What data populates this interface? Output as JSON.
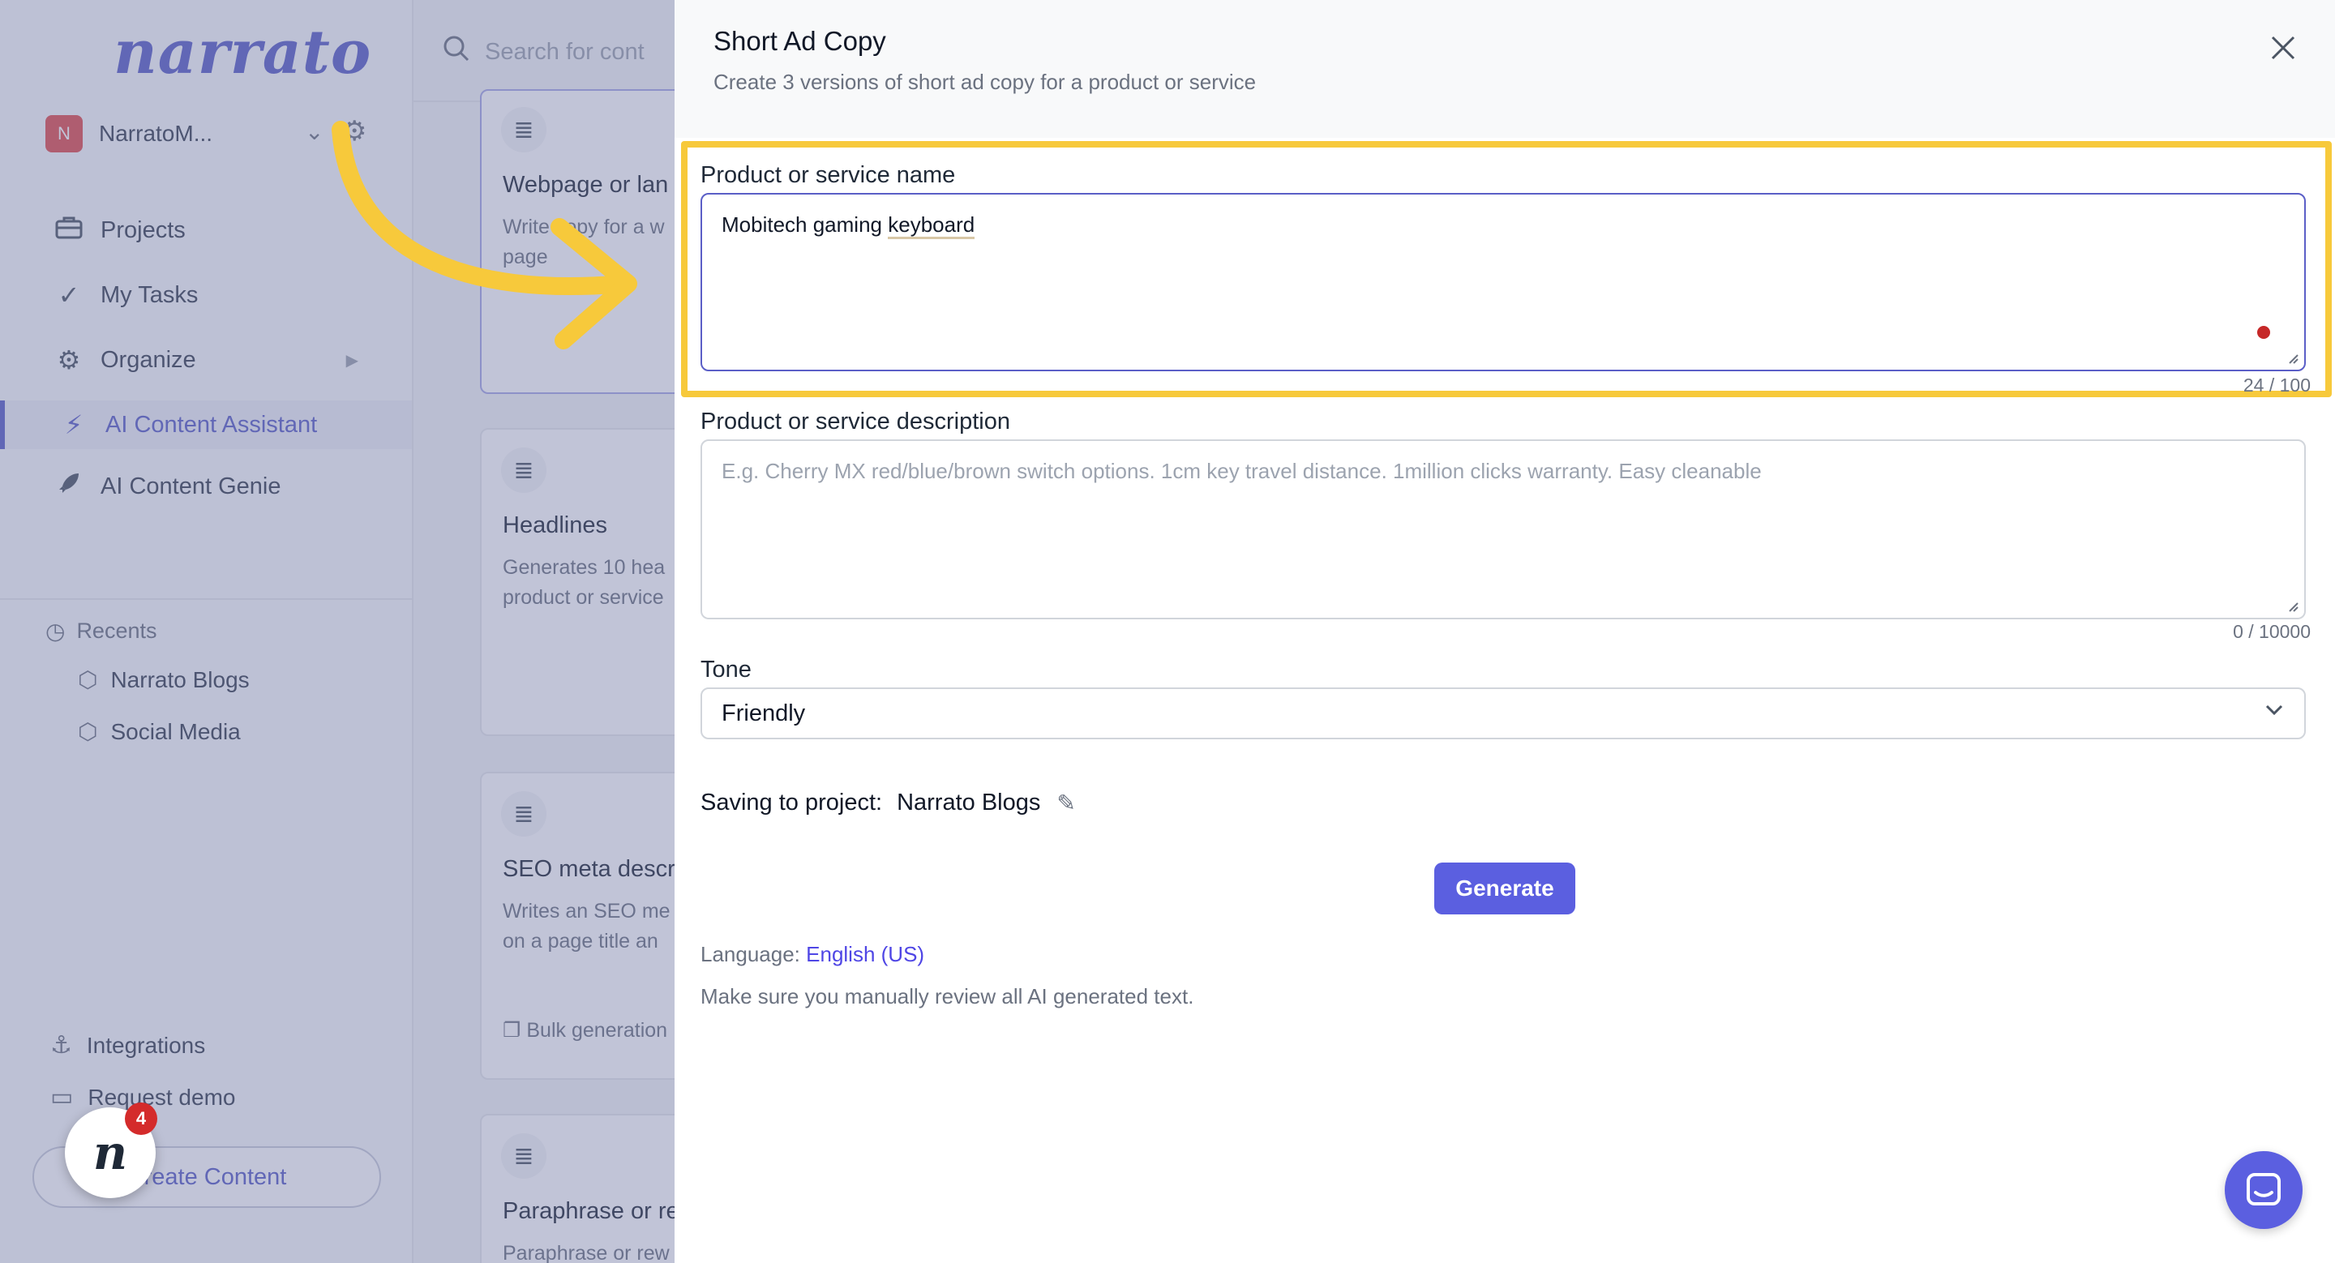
{
  "sidebar": {
    "logo": "narrato",
    "workspace": {
      "initial": "N",
      "name": "NarratoM..."
    },
    "nav": [
      {
        "label": "Projects",
        "icon": "briefcase-icon"
      },
      {
        "label": "My Tasks",
        "icon": "checkmark-icon"
      },
      {
        "label": "Organize",
        "icon": "gears-icon"
      },
      {
        "label": "AI Content Assistant",
        "icon": "lightning-icon"
      },
      {
        "label": "AI Content Genie",
        "icon": "rocket-icon"
      }
    ],
    "recents_label": "Recents",
    "recents": [
      "Narrato Blogs",
      "Social Media"
    ],
    "bottom": [
      {
        "label": "Integrations",
        "icon": "anchor-icon"
      },
      {
        "label": "Request demo",
        "icon": "monitor-icon"
      }
    ],
    "create_label": "Create Content",
    "chat_badge": "4",
    "chat_letter": "n"
  },
  "middle": {
    "search_placeholder": "Search for cont",
    "cards": [
      {
        "title": "Webpage or lan",
        "desc": "Write copy for a w page"
      },
      {
        "title": "Headlines",
        "desc": "Generates 10 hea product or service"
      },
      {
        "title": "SEO meta descr",
        "desc": "Writes an SEO me on a page title an",
        "foot": "Bulk generation"
      },
      {
        "title": "Paraphrase or re",
        "desc": "Paraphrase or rew"
      }
    ]
  },
  "panel": {
    "title": "Short Ad Copy",
    "subtitle": "Create 3 versions of short ad copy for a product or service",
    "fields": {
      "name": {
        "label": "Product or service name",
        "value_prefix": "Mobitech gaming ",
        "value_keyword": "keyboard",
        "counter": "24 / 100"
      },
      "description": {
        "label": "Product or service description",
        "placeholder": "E.g. Cherry MX red/blue/brown switch options. 1cm key travel distance. 1million clicks warranty. Easy cleanable",
        "counter": "0 / 10000"
      },
      "tone": {
        "label": "Tone",
        "value": "Friendly"
      }
    },
    "saving_label": "Saving to project:",
    "saving_project": "Narrato Blogs",
    "generate_label": "Generate",
    "language_label": "Language:",
    "language_value": "English (US)",
    "note": "Make sure you manually review all AI generated text."
  },
  "colors": {
    "accent": "#5b5fe0",
    "highlight": "#f7c93b",
    "overlay": "#6b72a0",
    "arrow": "#f7c93b"
  }
}
